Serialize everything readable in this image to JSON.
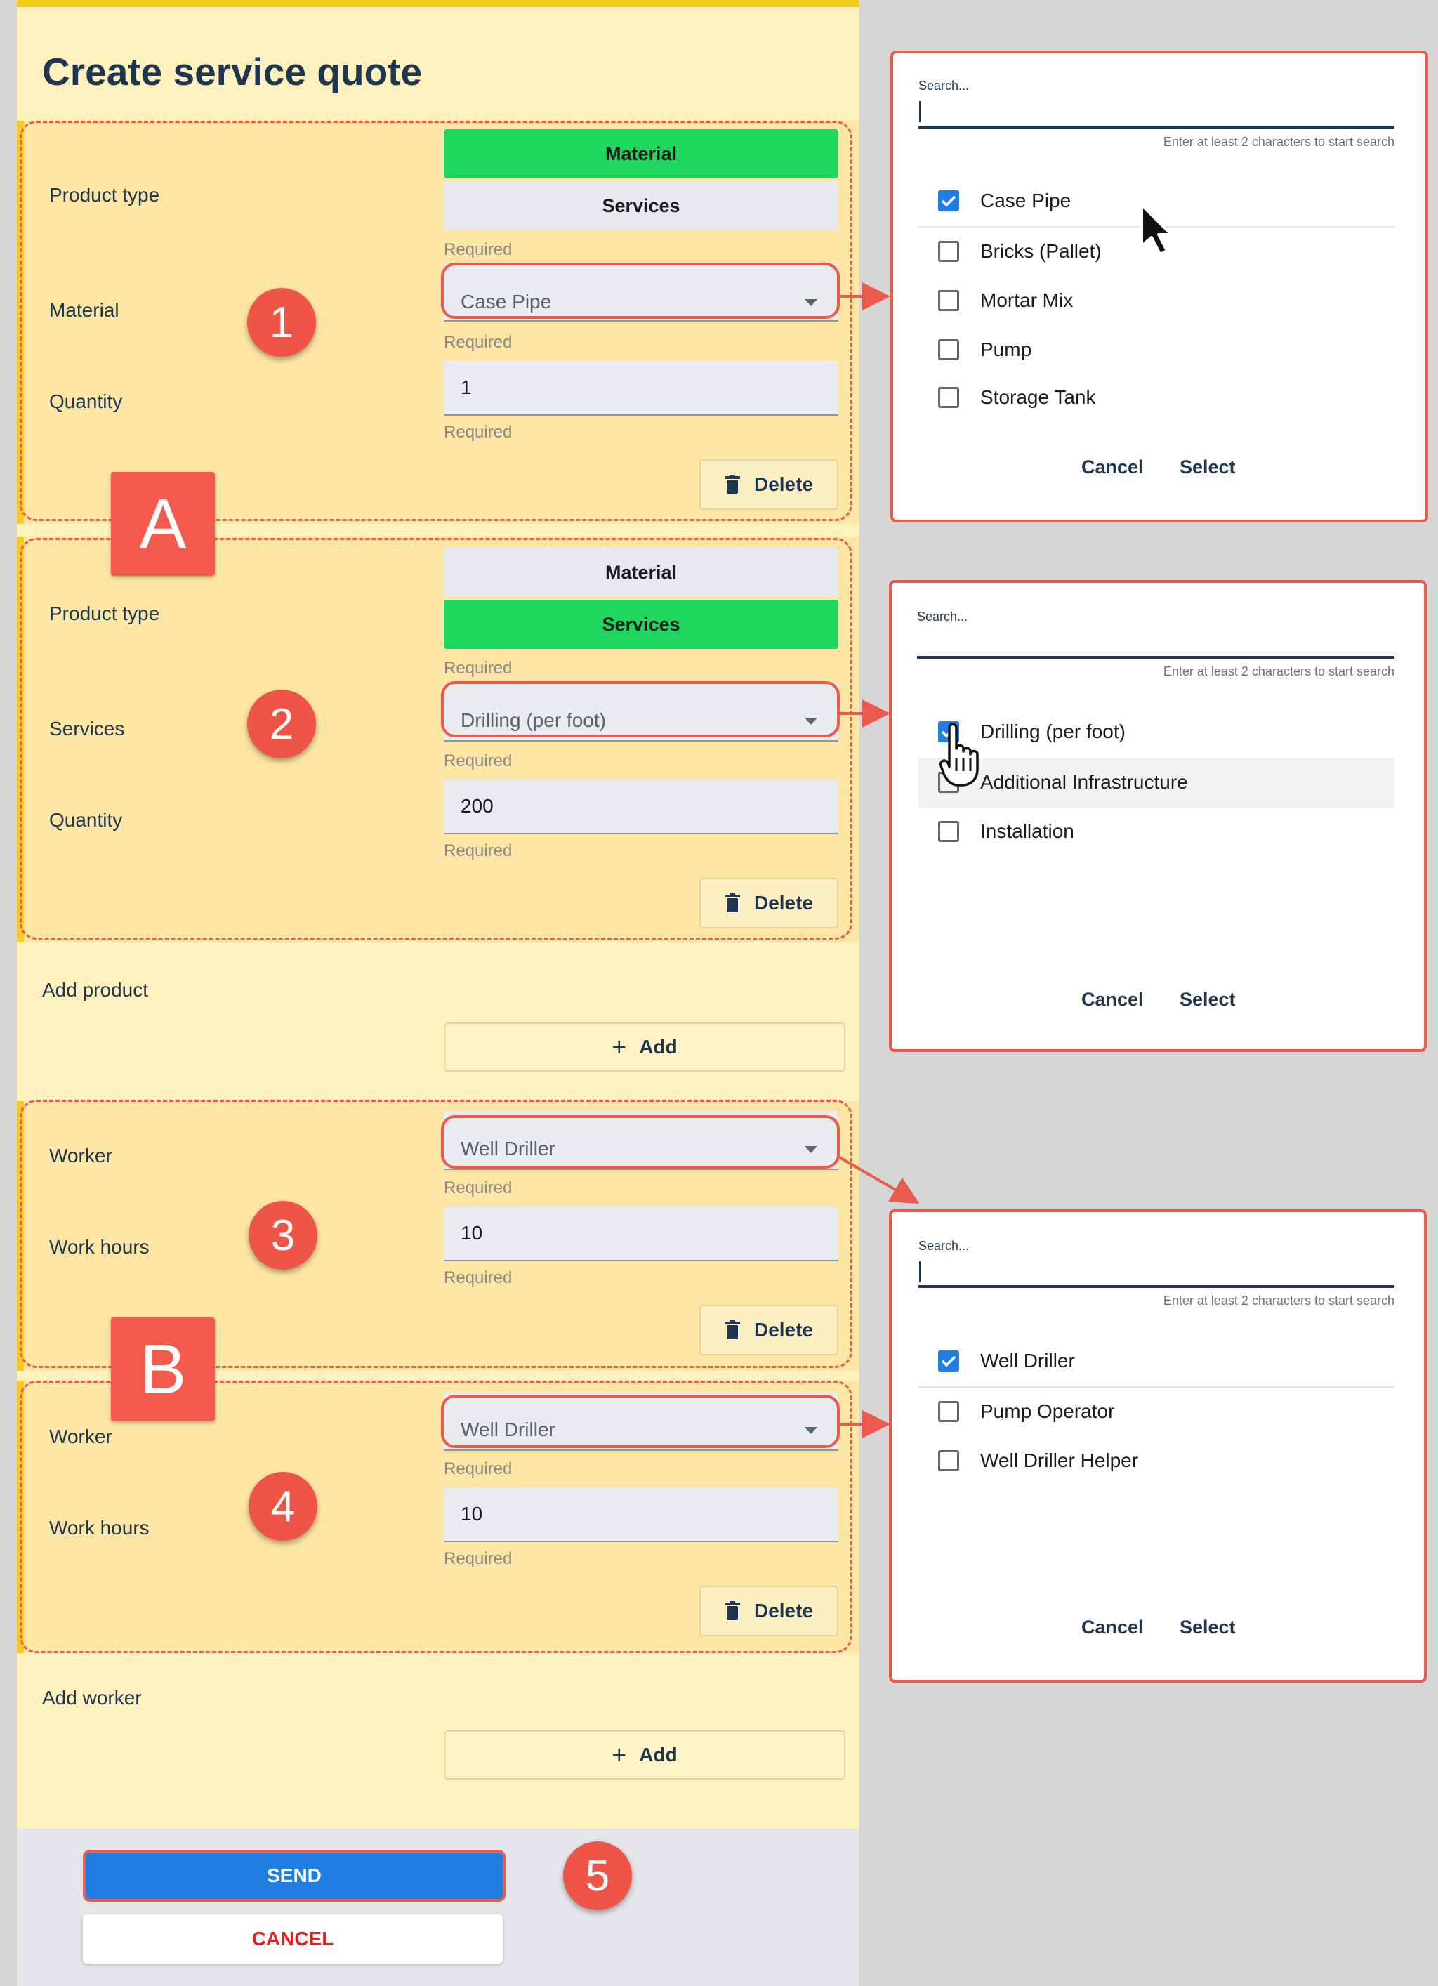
{
  "form": {
    "title": "Create service quote",
    "required_label": "Required",
    "product_type_label": "Product type",
    "material_label": "Material",
    "services_label": "Services",
    "quantity_label": "Quantity",
    "worker_label": "Worker",
    "work_hours_label": "Work hours",
    "delete_label": "Delete",
    "add_label": "Add",
    "add_product_label": "Add product",
    "add_worker_label": "Add worker",
    "toggle_material": "Material",
    "toggle_services": "Services",
    "products": [
      {
        "type_selected": "Material",
        "select_value": "Case Pipe",
        "quantity": "1"
      },
      {
        "type_selected": "Services",
        "select_value": "Drilling (per foot)",
        "quantity": "200"
      }
    ],
    "workers": [
      {
        "worker": "Well Driller",
        "hours": "10"
      },
      {
        "worker": "Well Driller",
        "hours": "10"
      }
    ],
    "send_label": "SEND",
    "cancel_label": "CANCEL"
  },
  "annotations": {
    "badges": [
      "1",
      "2",
      "3",
      "4",
      "5"
    ],
    "letters": [
      "A",
      "B"
    ]
  },
  "dialogs": [
    {
      "search_label": "Search...",
      "hint": "Enter at least 2 characters to start search",
      "options": [
        {
          "label": "Case Pipe",
          "checked": true
        },
        {
          "label": "Bricks (Pallet)",
          "checked": false
        },
        {
          "label": "Mortar Mix",
          "checked": false
        },
        {
          "label": "Pump",
          "checked": false
        },
        {
          "label": "Storage Tank",
          "checked": false
        }
      ],
      "cancel": "Cancel",
      "select": "Select"
    },
    {
      "search_label": "Search...",
      "hint": "Enter at least 2 characters to start search",
      "options": [
        {
          "label": "Drilling (per foot)",
          "checked": true
        },
        {
          "label": "Additional Infrastructure",
          "checked": false
        },
        {
          "label": "Installation",
          "checked": false
        }
      ],
      "cancel": "Cancel",
      "select": "Select"
    },
    {
      "search_label": "Search...",
      "hint": "Enter at least 2 characters to start search",
      "options": [
        {
          "label": "Well Driller",
          "checked": true
        },
        {
          "label": "Pump Operator",
          "checked": false
        },
        {
          "label": "Well Driller Helper",
          "checked": false
        }
      ],
      "cancel": "Cancel",
      "select": "Select"
    }
  ],
  "colors": {
    "accent_green": "#1fd65f",
    "primary_blue": "#1e7fe0",
    "annotation_red": "#ea5a4d",
    "panel_yellow": "#fff1bd"
  }
}
